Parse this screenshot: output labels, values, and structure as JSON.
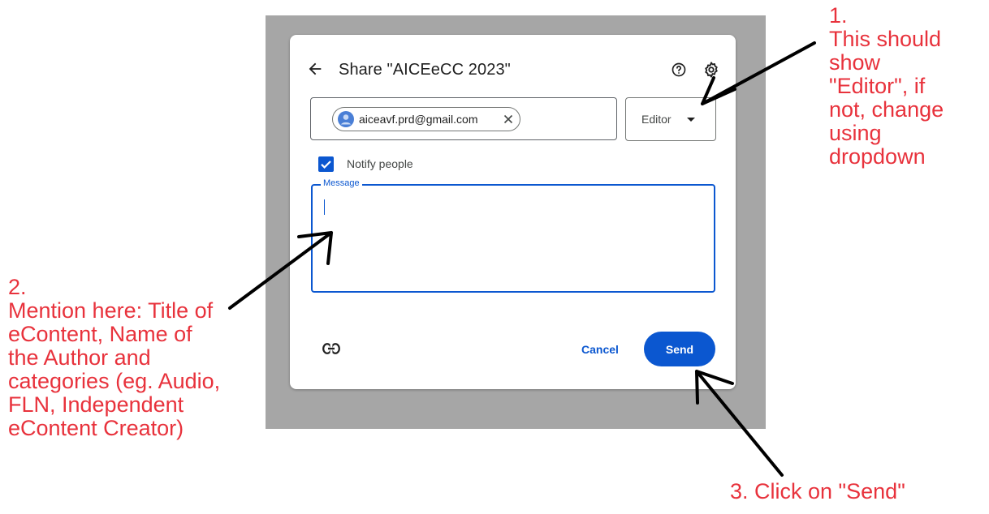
{
  "dialog": {
    "title": "Share \"AICEeCC 2023\"",
    "recipient_chip": "aiceavf.prd@gmail.com",
    "role_value": "Editor",
    "notify_label": "Notify people",
    "notify_checked": true,
    "message_label": "Message",
    "message_value": "",
    "cancel_label": "Cancel",
    "send_label": "Send",
    "accent_color": "#0b57d0"
  },
  "annotations": {
    "note1_lines": [
      "1.",
      "This should",
      "show",
      "\"Editor\", if",
      "not, change",
      "using",
      "dropdown"
    ],
    "note2_lines": [
      "2.",
      "Mention here: Title of",
      "eContent, Name of",
      "the Author  and",
      "categories (eg. Audio,",
      "FLN, Independent",
      "eContent Creator)"
    ],
    "note3_text": "3. Click on \"Send\"",
    "annotation_color": "#e8323c"
  },
  "icons": {
    "back": "arrow-back-icon",
    "help": "help-icon",
    "settings": "gear-icon",
    "avatar": "avatar-icon",
    "remove": "close-icon",
    "dropdown": "dropdown-arrow-icon",
    "checkbox": "checkbox-icon",
    "link": "link-icon"
  }
}
